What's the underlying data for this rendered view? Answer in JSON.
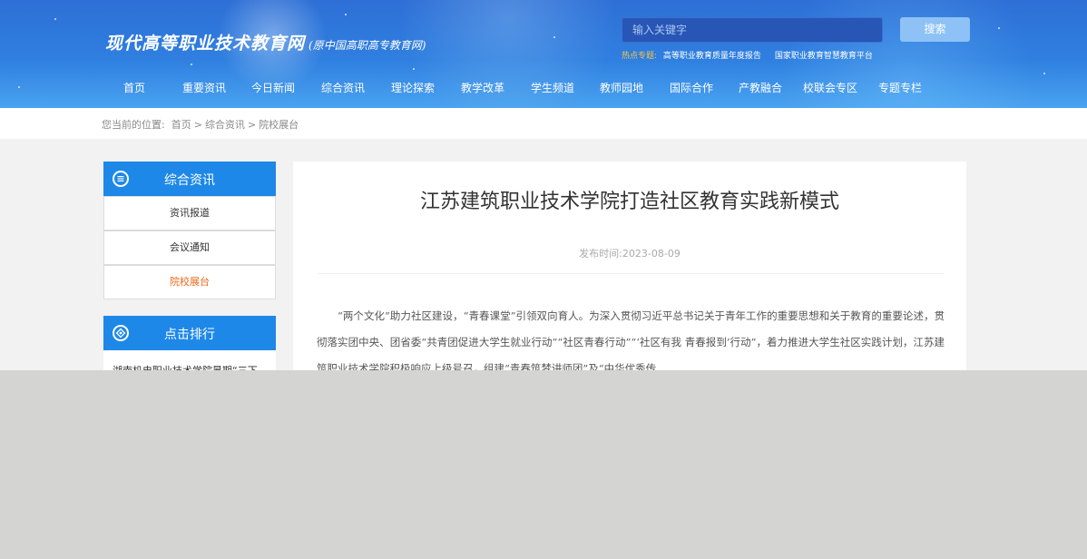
{
  "header": {
    "site_title": "现代高等职业技术教育网",
    "site_subtitle": "(原中国高职高专教育网)",
    "search_placeholder": "输入关键字",
    "search_button": "搜索",
    "hot_label": "热点专题:",
    "hot_links": [
      "高等职业教育质量年度报告",
      "国家职业教育智慧教育平台"
    ]
  },
  "nav": {
    "items": [
      "首页",
      "重要资讯",
      "今日新闻",
      "综合资讯",
      "理论探索",
      "教学改革",
      "学生频道",
      "教师园地",
      "国际合作",
      "产教融合",
      "校联会专区",
      "专题专栏"
    ]
  },
  "breadcrumb": {
    "prefix": "您当前的位置:",
    "items": [
      "首页",
      "综合资讯",
      "院校展台"
    ],
    "separator": ">"
  },
  "sidebar": {
    "section1_title": "综合资讯",
    "section1_items": [
      "资讯报道",
      "会议通知",
      "院校展台"
    ],
    "section2_title": "点击排行",
    "rank_items": [
      "湖南机电职业技术学院暑期“三下"
    ]
  },
  "article": {
    "title": "江苏建筑职业技术学院打造社区教育实践新模式",
    "date_label": "发布时间:",
    "date": "2023-08-09",
    "body": "“两个文化”助力社区建设，“青春课堂”引领双向育人。为深入贯彻习近平总书记关于青年工作的重要思想和关于教育的重要论述，贯彻落实团中央、团省委“共青团促进大学生就业行动”“社区青春行动”“‘社区有我 青春报到’行动”，着力推进大学生社区实践计划，江苏建筑职业技术学院积极响应上级号召，组建“青春筑梦讲师团”及“中华优秀传"
  },
  "colors": {
    "accent": "#1e88e8",
    "active": "#ee6a1d",
    "hot_label": "#f3c64b"
  },
  "icons": [
    "menu-circle-icon",
    "ranking-circle-icon"
  ]
}
